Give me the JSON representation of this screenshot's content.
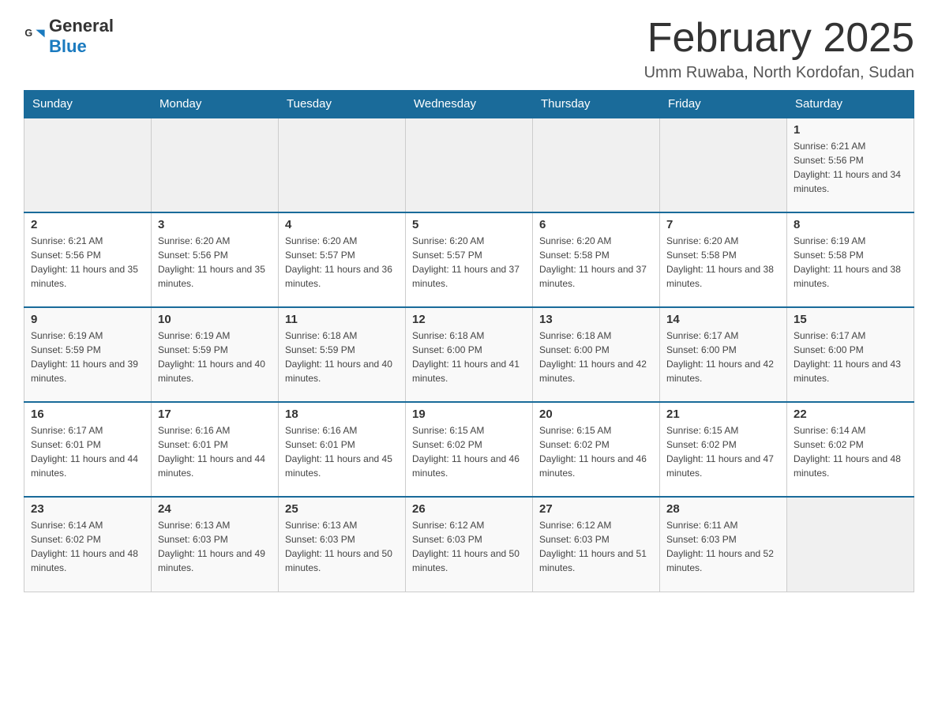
{
  "header": {
    "logo": {
      "text_general": "General",
      "text_blue": "Blue"
    },
    "title": "February 2025",
    "subtitle": "Umm Ruwaba, North Kordofan, Sudan"
  },
  "days_of_week": [
    "Sunday",
    "Monday",
    "Tuesday",
    "Wednesday",
    "Thursday",
    "Friday",
    "Saturday"
  ],
  "weeks": [
    [
      {
        "day": "",
        "info": ""
      },
      {
        "day": "",
        "info": ""
      },
      {
        "day": "",
        "info": ""
      },
      {
        "day": "",
        "info": ""
      },
      {
        "day": "",
        "info": ""
      },
      {
        "day": "",
        "info": ""
      },
      {
        "day": "1",
        "info": "Sunrise: 6:21 AM\nSunset: 5:56 PM\nDaylight: 11 hours and 34 minutes."
      }
    ],
    [
      {
        "day": "2",
        "info": "Sunrise: 6:21 AM\nSunset: 5:56 PM\nDaylight: 11 hours and 35 minutes."
      },
      {
        "day": "3",
        "info": "Sunrise: 6:20 AM\nSunset: 5:56 PM\nDaylight: 11 hours and 35 minutes."
      },
      {
        "day": "4",
        "info": "Sunrise: 6:20 AM\nSunset: 5:57 PM\nDaylight: 11 hours and 36 minutes."
      },
      {
        "day": "5",
        "info": "Sunrise: 6:20 AM\nSunset: 5:57 PM\nDaylight: 11 hours and 37 minutes."
      },
      {
        "day": "6",
        "info": "Sunrise: 6:20 AM\nSunset: 5:58 PM\nDaylight: 11 hours and 37 minutes."
      },
      {
        "day": "7",
        "info": "Sunrise: 6:20 AM\nSunset: 5:58 PM\nDaylight: 11 hours and 38 minutes."
      },
      {
        "day": "8",
        "info": "Sunrise: 6:19 AM\nSunset: 5:58 PM\nDaylight: 11 hours and 38 minutes."
      }
    ],
    [
      {
        "day": "9",
        "info": "Sunrise: 6:19 AM\nSunset: 5:59 PM\nDaylight: 11 hours and 39 minutes."
      },
      {
        "day": "10",
        "info": "Sunrise: 6:19 AM\nSunset: 5:59 PM\nDaylight: 11 hours and 40 minutes."
      },
      {
        "day": "11",
        "info": "Sunrise: 6:18 AM\nSunset: 5:59 PM\nDaylight: 11 hours and 40 minutes."
      },
      {
        "day": "12",
        "info": "Sunrise: 6:18 AM\nSunset: 6:00 PM\nDaylight: 11 hours and 41 minutes."
      },
      {
        "day": "13",
        "info": "Sunrise: 6:18 AM\nSunset: 6:00 PM\nDaylight: 11 hours and 42 minutes."
      },
      {
        "day": "14",
        "info": "Sunrise: 6:17 AM\nSunset: 6:00 PM\nDaylight: 11 hours and 42 minutes."
      },
      {
        "day": "15",
        "info": "Sunrise: 6:17 AM\nSunset: 6:00 PM\nDaylight: 11 hours and 43 minutes."
      }
    ],
    [
      {
        "day": "16",
        "info": "Sunrise: 6:17 AM\nSunset: 6:01 PM\nDaylight: 11 hours and 44 minutes."
      },
      {
        "day": "17",
        "info": "Sunrise: 6:16 AM\nSunset: 6:01 PM\nDaylight: 11 hours and 44 minutes."
      },
      {
        "day": "18",
        "info": "Sunrise: 6:16 AM\nSunset: 6:01 PM\nDaylight: 11 hours and 45 minutes."
      },
      {
        "day": "19",
        "info": "Sunrise: 6:15 AM\nSunset: 6:02 PM\nDaylight: 11 hours and 46 minutes."
      },
      {
        "day": "20",
        "info": "Sunrise: 6:15 AM\nSunset: 6:02 PM\nDaylight: 11 hours and 46 minutes."
      },
      {
        "day": "21",
        "info": "Sunrise: 6:15 AM\nSunset: 6:02 PM\nDaylight: 11 hours and 47 minutes."
      },
      {
        "day": "22",
        "info": "Sunrise: 6:14 AM\nSunset: 6:02 PM\nDaylight: 11 hours and 48 minutes."
      }
    ],
    [
      {
        "day": "23",
        "info": "Sunrise: 6:14 AM\nSunset: 6:02 PM\nDaylight: 11 hours and 48 minutes."
      },
      {
        "day": "24",
        "info": "Sunrise: 6:13 AM\nSunset: 6:03 PM\nDaylight: 11 hours and 49 minutes."
      },
      {
        "day": "25",
        "info": "Sunrise: 6:13 AM\nSunset: 6:03 PM\nDaylight: 11 hours and 50 minutes."
      },
      {
        "day": "26",
        "info": "Sunrise: 6:12 AM\nSunset: 6:03 PM\nDaylight: 11 hours and 50 minutes."
      },
      {
        "day": "27",
        "info": "Sunrise: 6:12 AM\nSunset: 6:03 PM\nDaylight: 11 hours and 51 minutes."
      },
      {
        "day": "28",
        "info": "Sunrise: 6:11 AM\nSunset: 6:03 PM\nDaylight: 11 hours and 52 minutes."
      },
      {
        "day": "",
        "info": ""
      }
    ]
  ]
}
